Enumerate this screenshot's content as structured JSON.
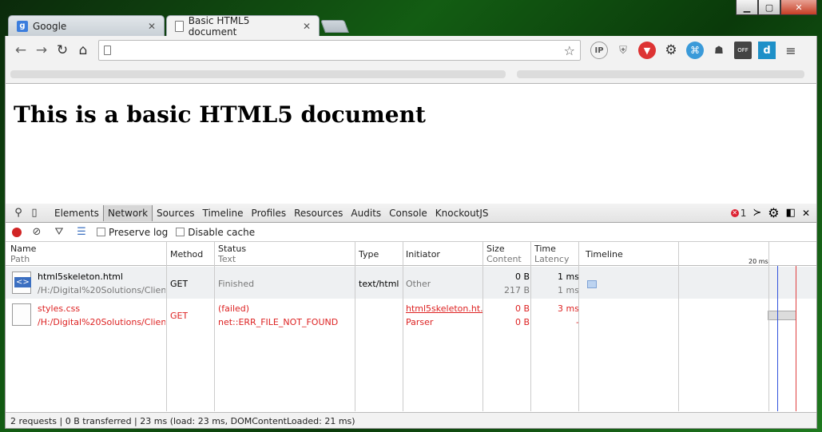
{
  "window": {
    "minimize": "▁",
    "maximize": "▢",
    "close": "✕"
  },
  "tabs": [
    {
      "title": "Google",
      "active": false
    },
    {
      "title": "Basic HTML5 document",
      "active": true
    }
  ],
  "toolbar": {
    "url_value": "",
    "extensions": [
      "IP",
      "ghostery-icon",
      "ublock-icon",
      "gear-icon",
      "swirl-icon",
      "ghost-icon",
      "OFF",
      "d"
    ]
  },
  "page": {
    "heading": "This is a basic HTML5 document"
  },
  "devtools": {
    "panels": [
      "Elements",
      "Network",
      "Sources",
      "Timeline",
      "Profiles",
      "Resources",
      "Audits",
      "Console",
      "KnockoutJS"
    ],
    "active_panel": "Network",
    "error_count": "1",
    "preserve_log": "Preserve log",
    "disable_cache": "Disable cache",
    "columns": {
      "name": "Name",
      "name_sub": "Path",
      "method": "Method",
      "status": "Status",
      "status_sub": "Text",
      "type": "Type",
      "initiator": "Initiator",
      "size": "Size",
      "size_sub": "Content",
      "time": "Time",
      "time_sub": "Latency",
      "timeline": "Timeline",
      "timeline_scale": "20 ms"
    },
    "requests": [
      {
        "name": "html5skeleton.html",
        "path": "/H:/Digital%20Solutions/Clien...",
        "method": "GET",
        "status": "",
        "status_text": "Finished",
        "type": "text/html",
        "initiator": "Other",
        "initiator_sub": "",
        "size": "0 B",
        "content": "217 B",
        "time": "1 ms",
        "latency": "1 ms"
      },
      {
        "name": "styles.css",
        "path": "/H:/Digital%20Solutions/Clien...",
        "method": "GET",
        "status": "(failed)",
        "status_text": "net::ERR_FILE_NOT_FOUND",
        "type": "",
        "initiator": "html5skeleton.ht...",
        "initiator_sub": "Parser",
        "size": "0 B",
        "content": "0 B",
        "time": "3 ms",
        "latency": "-"
      }
    ],
    "summary": "2 requests | 0 B transferred | 23 ms (load: 23 ms, DOMContentLoaded: 21 ms)"
  }
}
